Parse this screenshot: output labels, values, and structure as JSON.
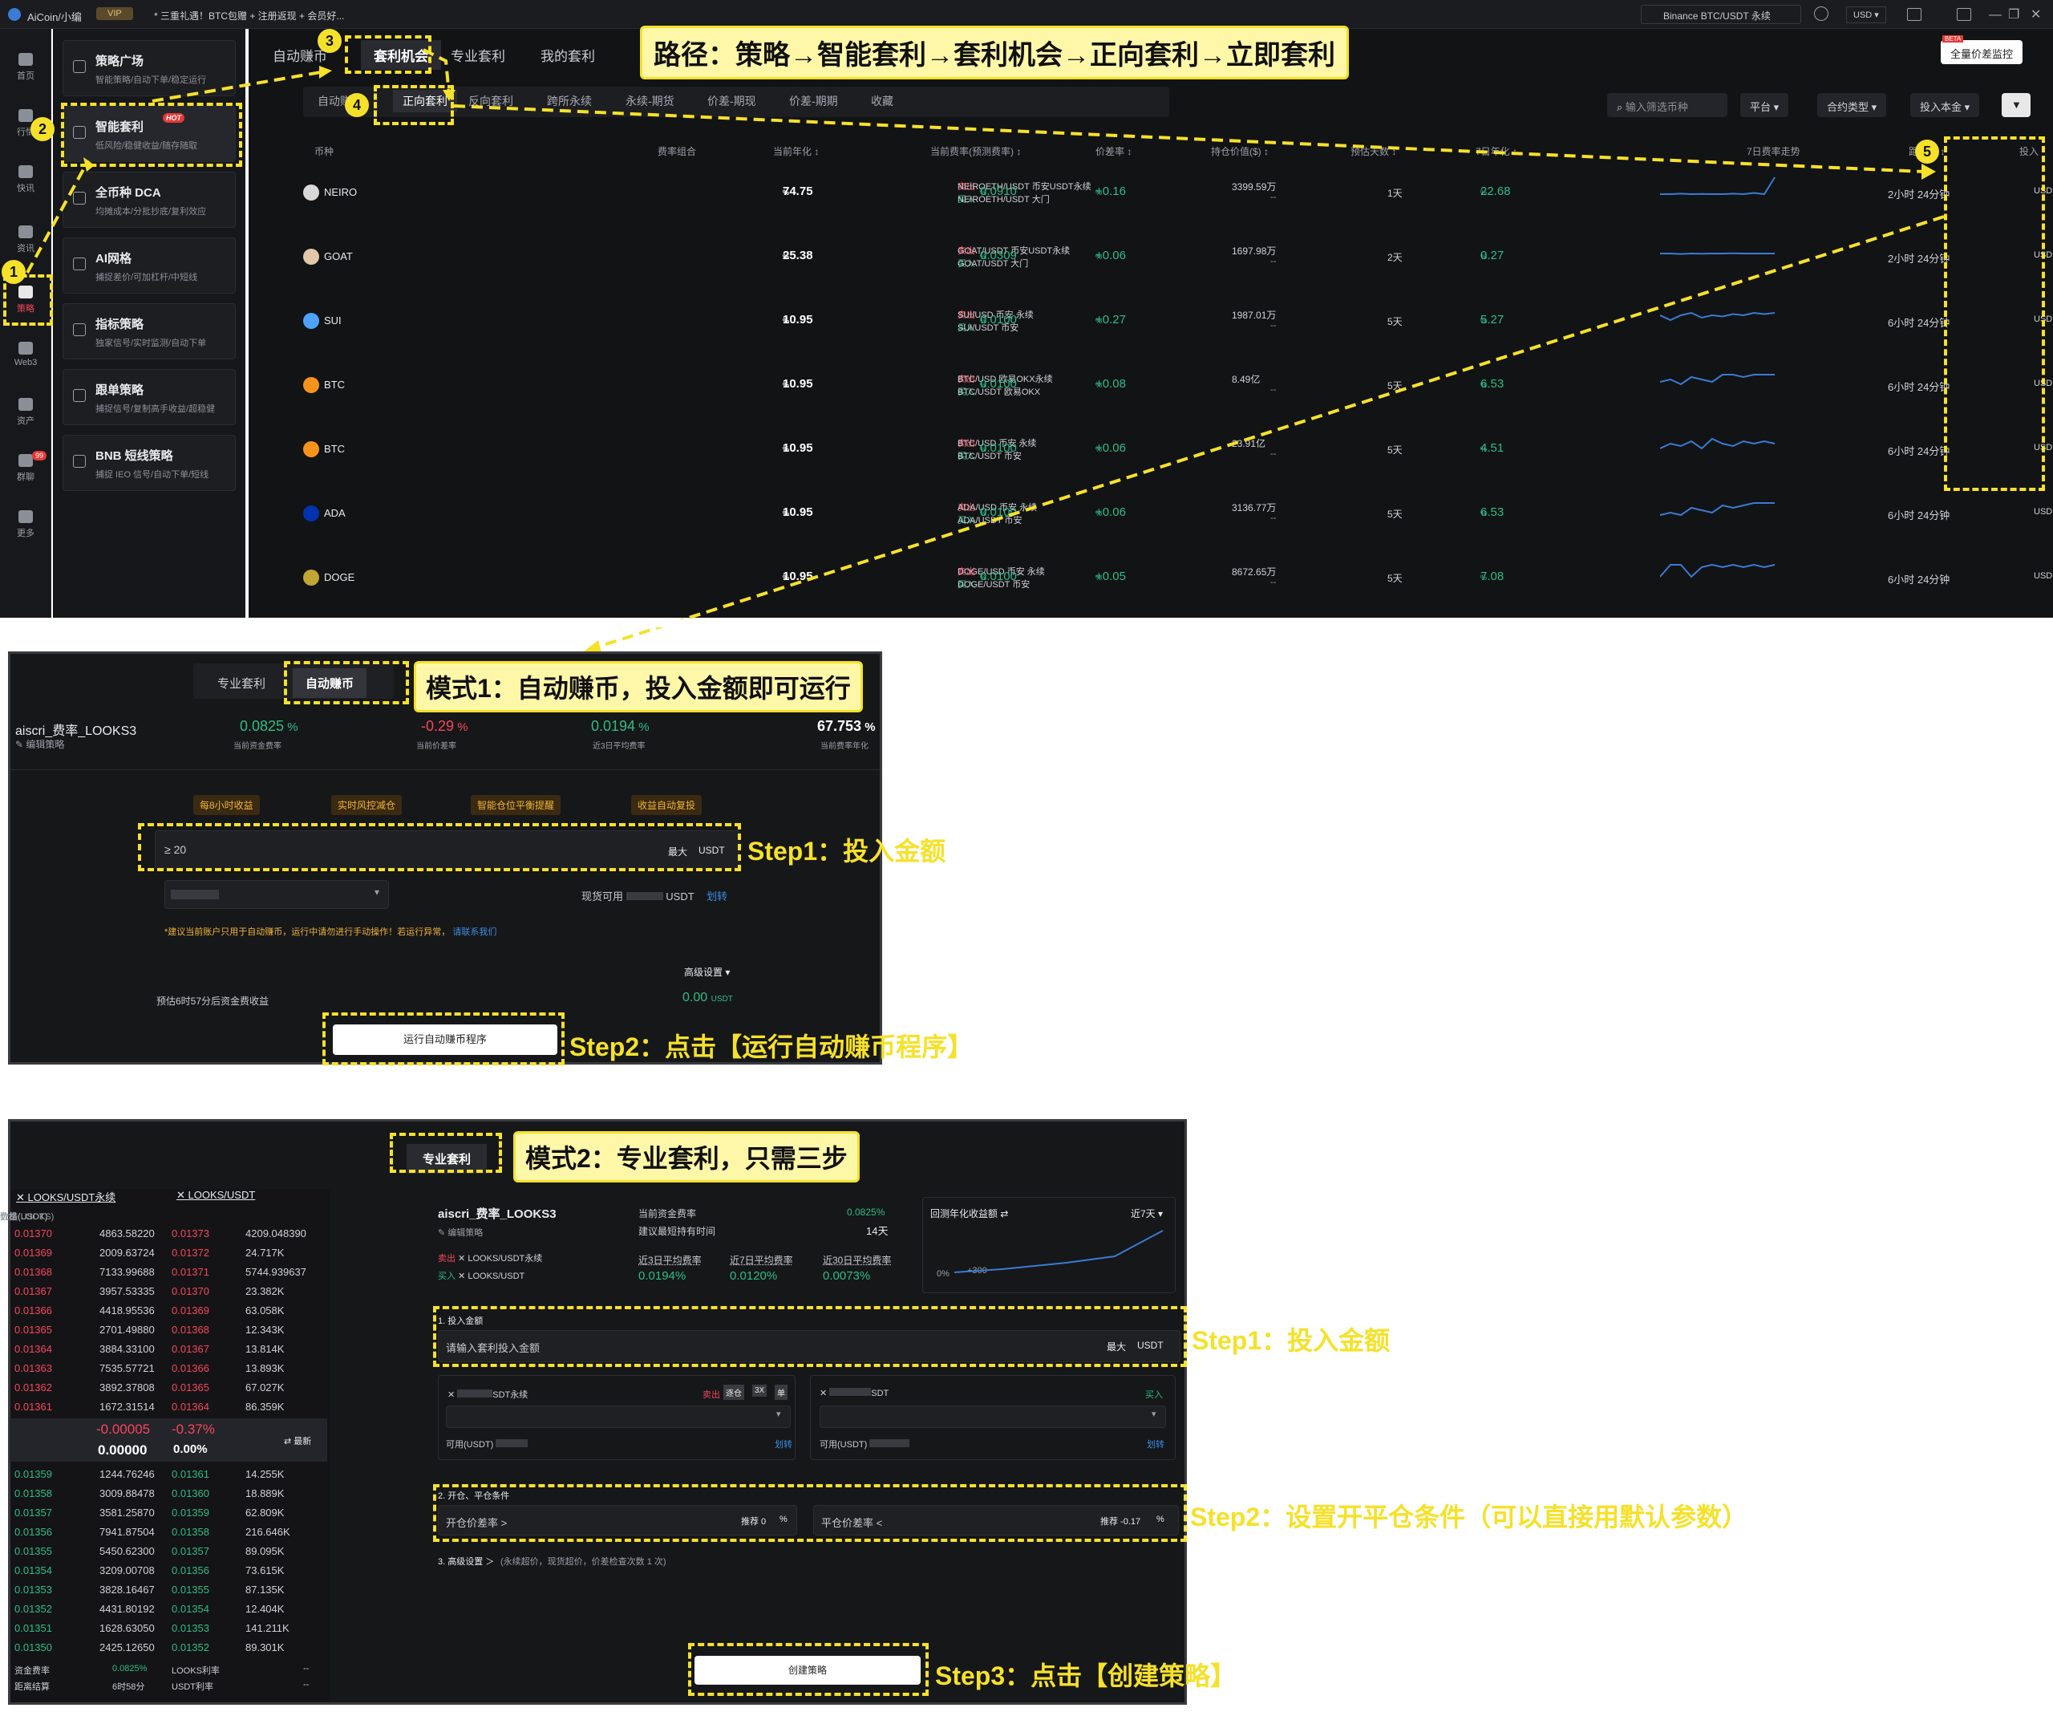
{
  "topbar": {
    "app": "AiCoin/小编",
    "vip": "VIP",
    "promo": "* 三重礼遇！BTC包赠 + 注册返现 + 会员好...",
    "search": "Binance BTC/USDT 永续",
    "currency": "USD ▾"
  },
  "leftnav": {
    "items": [
      "首页",
      "行情",
      "快讯",
      "资讯",
      "策略",
      "Web3",
      "资产",
      "群聊",
      "更多"
    ],
    "badge": "99"
  },
  "strategy_menu": [
    {
      "title": "策略广场",
      "desc": "智能策略/自动下单/稳定运行"
    },
    {
      "title": "智能套利",
      "desc": "低风险/稳健收益/随存随取",
      "hot": "HOT"
    },
    {
      "title": "全币种 DCA",
      "desc": "均摊成本/分批抄底/复利效应"
    },
    {
      "title": "AI网格",
      "desc": "捕捉差价/可加杠杆/中短线"
    },
    {
      "title": "指标策略",
      "desc": "独家信号/实时监测/自动下单"
    },
    {
      "title": "跟单策略",
      "desc": "捕捉信号/复制高手收益/超稳健"
    },
    {
      "title": "BNB 短线策略",
      "desc": "捕捉 IEO 信号/自动下单/短线"
    }
  ],
  "main": {
    "tabs": [
      "自动赚币",
      "套利机会",
      "专业套利",
      "我的套利"
    ],
    "subtabs": [
      "自动赚币",
      "正向套利",
      "反向套利",
      "跨所永续",
      "永续-期货",
      "价差-期现",
      "价差-期期",
      "收藏"
    ],
    "search_placeholder": "输入筛选币种",
    "filters": [
      "平台 ▾",
      "合约类型 ▾",
      "投入本金 ▾"
    ],
    "monitor_btn": "全量价差监控",
    "beta": "BETA",
    "headers": [
      "币种",
      "费率组合",
      "当前年化 ↕",
      "当前费率(预测费率) ↕",
      "价差率 ↕",
      "持仓价值($) ↕",
      "预估天数 ↕",
      "7日年化 ↕",
      "7日费率走势",
      "距结算 ↕",
      "投入"
    ],
    "rows": [
      {
        "coin": "NEIRO",
        "sell": "NEIROETH/USDT 币安USDT永续",
        "buy": "NEIROETH/USDT 大门",
        "apr": "74.75",
        "rate": "0.0910",
        "spread": "+0.16",
        "value": "3399.59万",
        "days": "1天",
        "apr7": "22.68",
        "settle": "2小时 24分钟",
        "unit": "USD"
      },
      {
        "coin": "GOAT",
        "sell": "GOAT/USDT 币安USDT永续",
        "buy": "GOAT/USDT 大门",
        "apr": "25.38",
        "rate": "0.0309",
        "spread": "+0.06",
        "value": "1697.98万",
        "days": "2天",
        "apr7": "0.27",
        "settle": "2小时 24分钟",
        "unit": "USD"
      },
      {
        "coin": "SUI",
        "sell": "SUI/USD 币安 永续",
        "buy": "SUI/USDT 币安",
        "apr": "10.95",
        "rate": "0.0100",
        "spread": "+0.27",
        "value": "1987.01万",
        "days": "5天",
        "apr7": "5.27",
        "settle": "6小时 24分钟",
        "unit": "USD"
      },
      {
        "coin": "BTC",
        "sell": "BTC/USD 欧易OKX永续",
        "buy": "BTC/USDT 欧易OKX",
        "apr": "10.95",
        "rate": "0.0100",
        "spread": "+0.08",
        "value": "8.49亿",
        "days": "5天",
        "apr7": "6.53",
        "settle": "6小时 24分钟",
        "unit": "USD"
      },
      {
        "coin": "BTC",
        "sell": "BTC/USD 币安 永续",
        "buy": "BTC/USDT 币安",
        "apr": "10.95",
        "rate": "0.0100",
        "spread": "+0.06",
        "value": "23.91亿",
        "days": "5天",
        "apr7": "4.51",
        "settle": "6小时 24分钟",
        "unit": "USD"
      },
      {
        "coin": "ADA",
        "sell": "ADA/USD 币安 永续",
        "buy": "ADA/USDT 币安",
        "apr": "10.95",
        "rate": "0.0100",
        "spread": "+0.06",
        "value": "3136.77万",
        "days": "5天",
        "apr7": "6.53",
        "settle": "6小时 24分钟",
        "unit": "USD"
      },
      {
        "coin": "DOGE",
        "sell": "DOGE/USD 币安 永续",
        "buy": "DOGE/USDT 币安",
        "apr": "10.95",
        "rate": "0.0100",
        "spread": "+0.05",
        "value": "8672.65万",
        "days": "5天",
        "apr7": "7.08",
        "settle": "6小时 24分钟",
        "unit": "USD"
      }
    ],
    "sell_label": "卖出",
    "buy_label": "买入",
    "pct": "%",
    "dash": "--"
  },
  "annotations": {
    "path": "路径：策略→智能套利→套利机会→正向套利→立即套利",
    "mode1": "模式1：自动赚币，投入金额即可运行",
    "mode1_step1": "Step1：投入金额",
    "mode1_step2": "Step2：点击【运行自动赚币程序】",
    "mode2": "模式2：专业套利，只需三步",
    "mode2_step1": "Step1：投入金额",
    "mode2_step2": "Step2：设置开平仓条件（可以直接用默认参数）",
    "mode2_step3": "Step3：点击【创建策略】",
    "nums": [
      "1",
      "2",
      "3",
      "4",
      "5"
    ]
  },
  "mode1": {
    "tabs": [
      "专业套利",
      "自动赚币"
    ],
    "name": "aiscri_费率_LOOKS3",
    "edit": "编辑策略",
    "stats": [
      {
        "v": "0.0825",
        "l": "当前资金费率"
      },
      {
        "v": "-0.29",
        "l": "当前价差率"
      },
      {
        "v": "0.0194",
        "l": "近3日平均费率"
      },
      {
        "v": "67.753",
        "l": "当前费率年化"
      }
    ],
    "tags": [
      "每8小时收益",
      "实时风控减仓",
      "智能仓位平衡提醒",
      "收益自动复投"
    ],
    "input": "≥ 20",
    "max": "最大",
    "unit": "USDT",
    "avail": "现货可用",
    "avail_unit": "USDT",
    "transfer": "划转",
    "notice": "*建议当前账户只用于自动赚币，运行中请勿进行手动操作！若运行异常，",
    "contact": "请联系我们",
    "advanced": "高级设置 ▾",
    "estimate": "预估6时57分后资金费收益",
    "est_val": "0.00",
    "est_unit": "USDT",
    "run": "运行自动赚币程序"
  },
  "mode2": {
    "tab": "专业套利",
    "book_pairs": [
      "LOOKS/USDT永续",
      "LOOKS/USDT"
    ],
    "book_headers": [
      "价格(USDT)",
      "数量(USDT)",
      "价格(USDT)",
      "数量(LOOKS)"
    ],
    "asks": [
      [
        "0.01370",
        "4863.58220",
        "0.01373",
        "4209.048390"
      ],
      [
        "0.01369",
        "2009.63724",
        "0.01372",
        "24.717K"
      ],
      [
        "0.01368",
        "7133.99688",
        "0.01371",
        "5744.939637"
      ],
      [
        "0.01367",
        "3957.53335",
        "0.01370",
        "23.382K"
      ],
      [
        "0.01366",
        "4418.95536",
        "0.01369",
        "63.058K"
      ],
      [
        "0.01365",
        "2701.49880",
        "0.01368",
        "12.343K"
      ],
      [
        "0.01364",
        "3884.33100",
        "0.01367",
        "13.814K"
      ],
      [
        "0.01363",
        "7535.57721",
        "0.01366",
        "13.893K"
      ],
      [
        "0.01362",
        "3892.37808",
        "0.01365",
        "67.027K"
      ],
      [
        "0.01361",
        "1672.31514",
        "0.01364",
        "86.359K"
      ]
    ],
    "mid": {
      "diff": "-0.00005",
      "pct": "-0.37%",
      "val": "0.00000",
      "val_pct": "0.00%",
      "latest": "⇄ 最新"
    },
    "bids": [
      [
        "0.01359",
        "1244.76246",
        "0.01361",
        "14.255K"
      ],
      [
        "0.01358",
        "3009.88478",
        "0.01360",
        "18.889K"
      ],
      [
        "0.01357",
        "3581.25870",
        "0.01359",
        "62.809K"
      ],
      [
        "0.01356",
        "7941.87504",
        "0.01358",
        "216.646K"
      ],
      [
        "0.01355",
        "5450.62300",
        "0.01357",
        "89.095K"
      ],
      [
        "0.01354",
        "3209.00708",
        "0.01356",
        "73.615K"
      ],
      [
        "0.01353",
        "3828.16467",
        "0.01355",
        "87.135K"
      ],
      [
        "0.01352",
        "4431.80192",
        "0.01354",
        "12.404K"
      ],
      [
        "0.01351",
        "1628.63050",
        "0.01353",
        "141.211K"
      ],
      [
        "0.01350",
        "2425.12650",
        "0.01352",
        "89.301K"
      ]
    ],
    "footer": [
      [
        "资金费率",
        "0.0825%",
        "LOOKS利率",
        "--"
      ],
      [
        "距离结算",
        "6时58分",
        "USDT利率",
        "--"
      ]
    ],
    "name": "aiscri_费率_LOOKS3",
    "edit": "编辑策略",
    "legs": [
      {
        "side": "卖出",
        "pair": "LOOKS/USDT永续"
      },
      {
        "side": "买入",
        "pair": "LOOKS/USDT"
      }
    ],
    "cur_rate_l": "当前资金费率",
    "cur_rate": "0.0825%",
    "hold_l": "建议最短持有时间",
    "hold": "14天",
    "avgs": [
      {
        "l": "近3日平均费率",
        "v": "0.0194%"
      },
      {
        "l": "近7日平均费率",
        "v": "0.0120%"
      },
      {
        "l": "近30日平均费率",
        "v": "0.0073%"
      }
    ],
    "chart_title": "回测年化收益额 ⇄",
    "chart_range": "近7天 ▾",
    "chart_0": "0%",
    "chart_300": "+300",
    "s1": "1. 投入金额",
    "s1_ph": "请输入套利投入金额",
    "max": "最大",
    "unit": "USDT",
    "leg_a": "SDT永续",
    "leg_b": "SDT",
    "sell": "卖出",
    "buy": "买入",
    "cross": "逐仓",
    "lev": "3X",
    "single": "单",
    "avail": "可用(USDT)",
    "transfer": "划转",
    "s2": "2. 开仓、平仓条件",
    "open": "开仓价差率 >",
    "open_rec": "推荐 0",
    "close": "平仓价差率 <",
    "close_rec": "推荐 -0.17",
    "pct": "%",
    "s3": "3. 高级设置 ＞",
    "s3_note": "(永续超价，现货超价，价差检查次数 1 次)",
    "create": "创建策略"
  },
  "chart_data": {
    "type": "line",
    "note": ""
  }
}
